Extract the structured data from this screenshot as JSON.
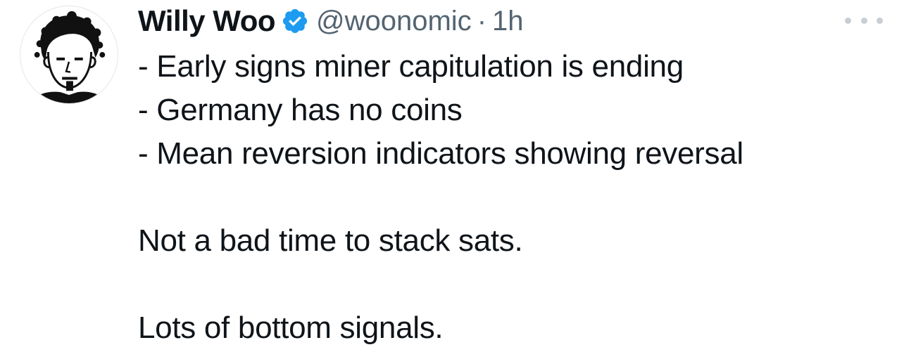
{
  "tweet": {
    "author": {
      "display_name": "Willy Woo",
      "handle": "@woonomic",
      "verified_icon": "verified-badge-icon",
      "avatar_icon": "avatar-pixel-portrait"
    },
    "separator": "·",
    "timestamp": "1h",
    "more_icon": "more-horizontal-icon",
    "lines": [
      "- Early signs miner capitulation is ending",
      "- Germany has no coins",
      "- Mean reversion indicators showing reversal"
    ],
    "paragraph_2": "Not a bad time to stack sats.",
    "paragraph_3": "Lots of bottom signals."
  },
  "colors": {
    "text": "#0f1419",
    "secondary": "#536471",
    "verified_blue": "#1d9bf0",
    "more_dots": "#c9ced3"
  }
}
